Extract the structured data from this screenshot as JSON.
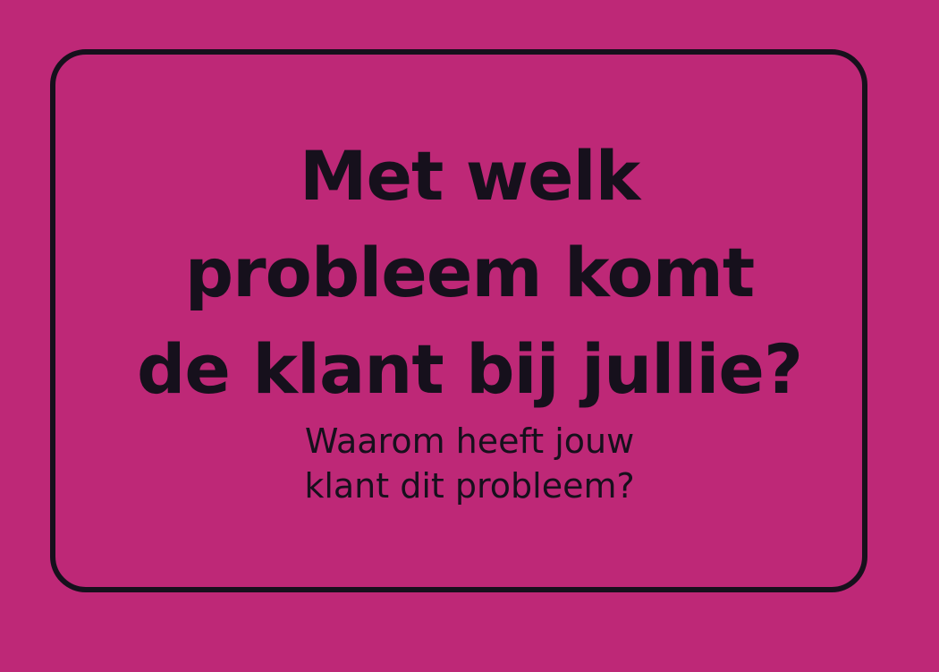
{
  "colors": {
    "background": "#be2877",
    "ink": "#16101c"
  },
  "question": {
    "lines": [
      "Met welk",
      "probleem komt",
      "de klant bij jullie?"
    ]
  },
  "subquestion": {
    "lines": [
      "Waarom heeft jouw",
      "klant dit probleem?"
    ]
  }
}
